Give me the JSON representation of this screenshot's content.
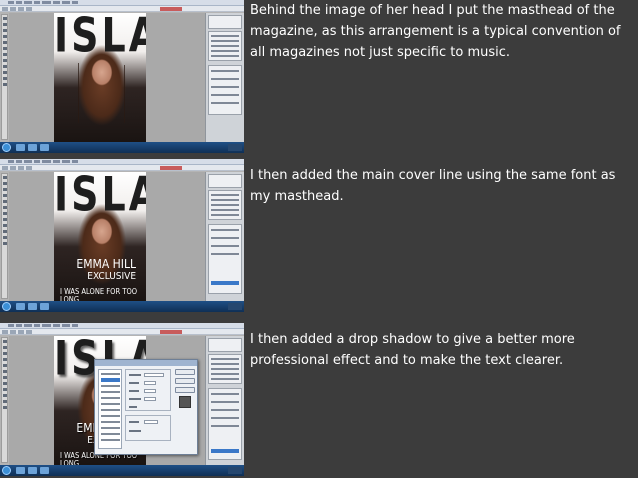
{
  "panels": [
    {
      "caption": "Behind the image of her head I put the masthead of the magazine, as this arrangement is a typical convention of all magazines not just specific to music.",
      "masthead": "ISLAND",
      "has_coverlines": false,
      "has_dialog": false
    },
    {
      "caption": "I then added the main cover line using the same font as my masthead.",
      "masthead": "ISLAND",
      "has_coverlines": true,
      "coverline_name": "EMMA HILL",
      "coverline_exclusive": "EXCLUSIVE",
      "coverline_song": "I WAS ALONE FOR TOO LONG",
      "has_dialog": false
    },
    {
      "caption": "I then added a drop shadow to give a better more professional effect and to make the text clearer.",
      "masthead": "ISLAND",
      "has_coverlines": true,
      "coverline_name": "EMMA HILL",
      "coverline_exclusive": "EXCLUSIVE",
      "coverline_song": "I WAS ALONE FOR TOO LONG",
      "has_dialog": true
    }
  ],
  "colors": {
    "slide_background": "#3c3c3c",
    "caption_text": "#ffffff",
    "taskbar": "#1f4f86",
    "selection": "#3a78c8"
  }
}
